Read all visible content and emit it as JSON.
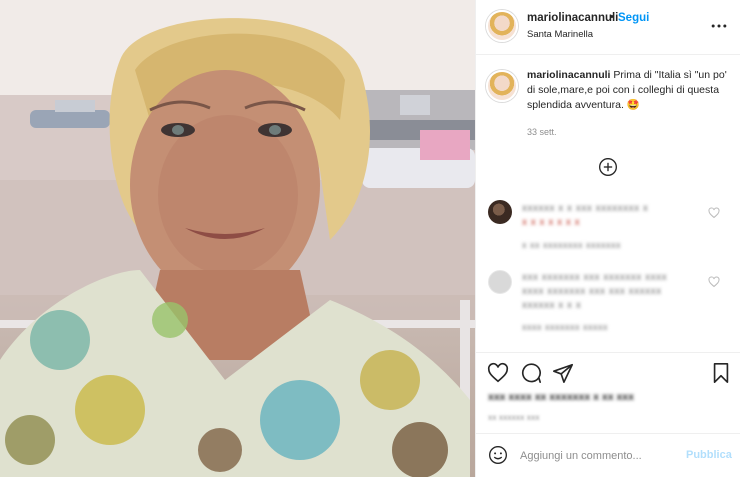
{
  "post": {
    "image_alt": "Blonde woman smiling in front of a harbor with boats",
    "author": {
      "username": "mariolinacannuli",
      "follow_label": "Segui",
      "separator": "•",
      "location": "Santa Marinella"
    },
    "caption": {
      "username": "mariolinacannuli",
      "text": "Prima di \"Italia sì \"un po' di sole,mare,e poi con i colleghi di questa splendida avventura. 🤩",
      "time": "33 sett."
    },
    "comments": [
      {
        "avatar": "photo-avatar",
        "line1": "xxxxxx x x xxx xxxxxxxx x",
        "line2": "x x x x x x x",
        "meta": "x xx  xxxxxxxx  xxxxxxx"
      },
      {
        "avatar": "default-avatar",
        "line1": "xxx xxxxxxx xxx xxxxxxx xxxx",
        "line2": "xxxx xxxxxxx xxx xxx xxxxxx",
        "line3": "xxxxxx x x x",
        "meta": "xxxx  xxxxxxx  xxxxx"
      }
    ],
    "likes_text": "xxx xxxx xx xxxxxxx x xx xxx",
    "date_text": "xx xxxxxx xxx",
    "comment_field": {
      "placeholder": "Aggiungi un commento...",
      "value": ""
    },
    "publish_label": "Pubblica",
    "colors": {
      "link_blue": "#0095f6",
      "publish_disabled": "#b2dffc",
      "border": "#efefef"
    }
  }
}
